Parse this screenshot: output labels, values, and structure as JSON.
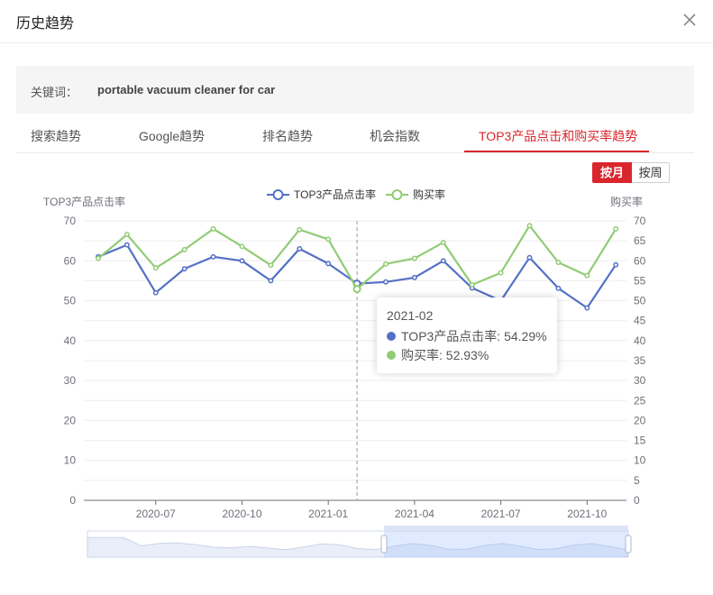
{
  "header": {
    "title": "历史趋势"
  },
  "keyword": {
    "label": "关键词：",
    "value": "portable vacuum cleaner for car"
  },
  "tabs": [
    {
      "label": "搜索趋势"
    },
    {
      "label": "Google趋势"
    },
    {
      "label": "排名趋势"
    },
    {
      "label": "机会指数"
    },
    {
      "label": "TOP3产品点击和购买率趋势"
    }
  ],
  "toggle": {
    "month": "按月",
    "week": "按周"
  },
  "tooltip": {
    "title": "2021-02",
    "rows": [
      {
        "label": "TOP3产品点击率: 54.29%",
        "color": "#5470c6"
      },
      {
        "label": "购买率: 52.93%",
        "color": "#91cc75"
      }
    ]
  },
  "chart_data": {
    "type": "line",
    "x": [
      "2020-05",
      "2020-06",
      "2020-07",
      "2020-08",
      "2020-09",
      "2020-10",
      "2020-11",
      "2020-12",
      "2021-01",
      "2021-02",
      "2021-03",
      "2021-04",
      "2021-05",
      "2021-06",
      "2021-07",
      "2021-08",
      "2021-09",
      "2021-10",
      "2021-11"
    ],
    "xtick_labels": [
      "2020-07",
      "2020-10",
      "2021-01",
      "2021-04",
      "2021-07",
      "2021-10"
    ],
    "series": [
      {
        "name": "TOP3产品点击率",
        "axis": "left",
        "color": "#5470c6",
        "values": [
          61,
          64,
          52,
          58,
          61,
          60,
          55,
          63,
          59.3,
          54.29,
          54.7,
          55.8,
          60,
          53.2,
          50,
          60.8,
          53.1,
          48.2,
          59
        ]
      },
      {
        "name": "购买率",
        "axis": "right",
        "color": "#91cc75",
        "values": [
          60.6,
          66.6,
          58.2,
          62.8,
          68,
          63.6,
          58.9,
          67.8,
          65.4,
          52.93,
          59.2,
          60.6,
          64.6,
          54,
          57,
          68.8,
          59.6,
          56.3,
          68
        ]
      }
    ],
    "ylabel_left": "TOP3产品点击率",
    "ylabel_right": "购买率",
    "ylim_left": [
      0,
      70
    ],
    "yticks_left": [
      0,
      10,
      20,
      30,
      40,
      50,
      60,
      70
    ],
    "ylim_right": [
      0,
      70
    ],
    "yticks_right": [
      0,
      5,
      10,
      15,
      20,
      25,
      30,
      35,
      40,
      45,
      50,
      55,
      60,
      65,
      70
    ],
    "grid": true,
    "legend": "top-center",
    "highlight_index": 9
  }
}
